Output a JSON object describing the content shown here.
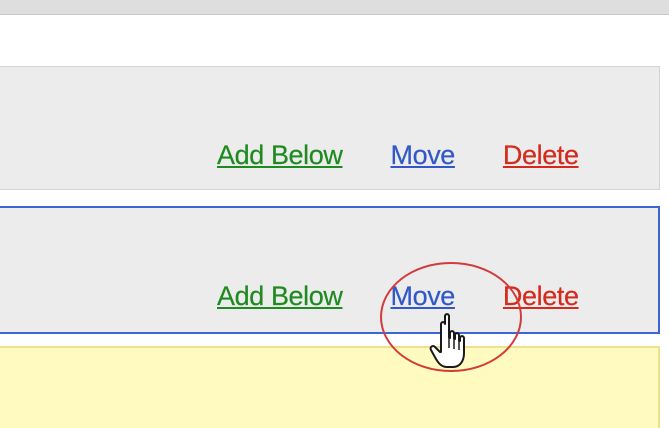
{
  "rows": [
    {
      "add_below": "Add Below",
      "move": "Move",
      "delete": "Delete"
    },
    {
      "add_below": "Add Below",
      "move": "Move",
      "delete": "Delete"
    }
  ],
  "colors": {
    "add": "#1f8a1f",
    "move": "#3257c9",
    "delete": "#d42a1e",
    "selected_border": "#3b67d6",
    "highlight": "#d33b3b",
    "new_row": "#fffbc0"
  },
  "icons": {
    "cursor": "hand-pointer-icon"
  }
}
